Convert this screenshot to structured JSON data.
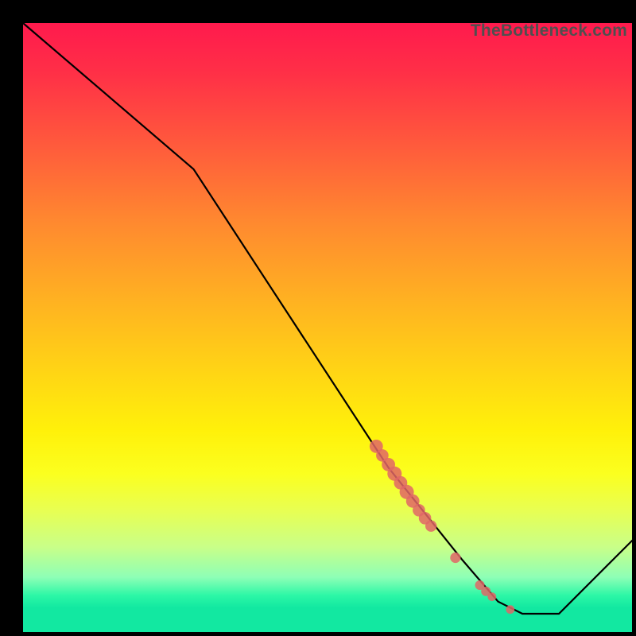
{
  "watermark": "TheBottleneck.com",
  "chart_data": {
    "type": "line",
    "title": "",
    "xlabel": "",
    "ylabel": "",
    "xlim": [
      0,
      100
    ],
    "ylim": [
      0,
      100
    ],
    "series": [
      {
        "name": "curve",
        "x": [
          0,
          28,
          60,
          72,
          78,
          82,
          88,
          100
        ],
        "values": [
          100,
          76,
          27,
          12,
          5,
          3,
          3,
          15
        ]
      }
    ],
    "markers": {
      "name": "highlighted-points",
      "color": "#e06666",
      "points": [
        {
          "x": 58.0,
          "y": 30.5,
          "r": 1.4
        },
        {
          "x": 59.0,
          "y": 29.0,
          "r": 1.3
        },
        {
          "x": 60.0,
          "y": 27.5,
          "r": 1.4
        },
        {
          "x": 61.0,
          "y": 26.0,
          "r": 1.5
        },
        {
          "x": 62.0,
          "y": 24.5,
          "r": 1.4
        },
        {
          "x": 63.0,
          "y": 23.0,
          "r": 1.5
        },
        {
          "x": 64.0,
          "y": 21.5,
          "r": 1.4
        },
        {
          "x": 65.0,
          "y": 20.0,
          "r": 1.3
        },
        {
          "x": 66.0,
          "y": 18.7,
          "r": 1.3
        },
        {
          "x": 67.0,
          "y": 17.4,
          "r": 1.2
        },
        {
          "x": 71.0,
          "y": 12.2,
          "r": 1.1
        },
        {
          "x": 75.0,
          "y": 7.7,
          "r": 1.0
        },
        {
          "x": 76.0,
          "y": 6.7,
          "r": 1.0
        },
        {
          "x": 77.0,
          "y": 5.8,
          "r": 0.9
        },
        {
          "x": 80.0,
          "y": 3.7,
          "r": 0.9
        }
      ]
    }
  }
}
